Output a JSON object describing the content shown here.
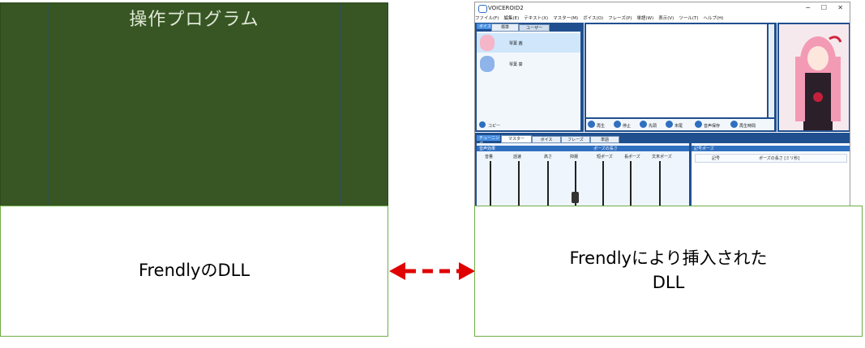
{
  "left": {
    "title": "操作プログラム",
    "dll_label": "FrendlyのDLL"
  },
  "right": {
    "dll_label_line1": "Frendlyにより挿入された",
    "dll_label_line2": "DLL"
  },
  "window": {
    "title": "VOICEROID2",
    "minimize": "−",
    "maximize": "☐",
    "close": "✕",
    "menu": [
      "ファイル(F)",
      "編集(E)",
      "テキスト(X)",
      "マスター(M)",
      "ボイス(O)",
      "フレーズ(P)",
      "単語(W)",
      "表示(V)",
      "ツール(T)",
      "ヘルプ(H)"
    ],
    "voice_tab_label": "ボイス",
    "voice_tabs": [
      "標準",
      "ユーザー"
    ],
    "voices": [
      "琴葉 茜",
      "琴葉 葵"
    ],
    "copy_label": "コピー",
    "play_buttons": [
      "再生",
      "停止",
      "先頭",
      "末尾",
      "音声保存",
      "再生時間"
    ],
    "tuning_label": "チューニング",
    "tuning_tabs": [
      "マスター",
      "ボイス",
      "フレーズ",
      "単語"
    ],
    "voice_effect_header": "音声効果",
    "pause_header": "ポーズの長さ",
    "sliders": [
      "音量",
      "話速",
      "高さ",
      "抑揚",
      "短ポーズ",
      "長ポーズ",
      "文末ポーズ"
    ],
    "symbol_pause_header": "記号ポーズ",
    "symbol_columns": [
      "記号",
      "ポーズの長さ [ミリ秒]"
    ],
    "accent": "#2f6fc0"
  },
  "colors": {
    "left_fill": "#375623",
    "box_border": "#70ad47",
    "arrow": "#e00000"
  }
}
